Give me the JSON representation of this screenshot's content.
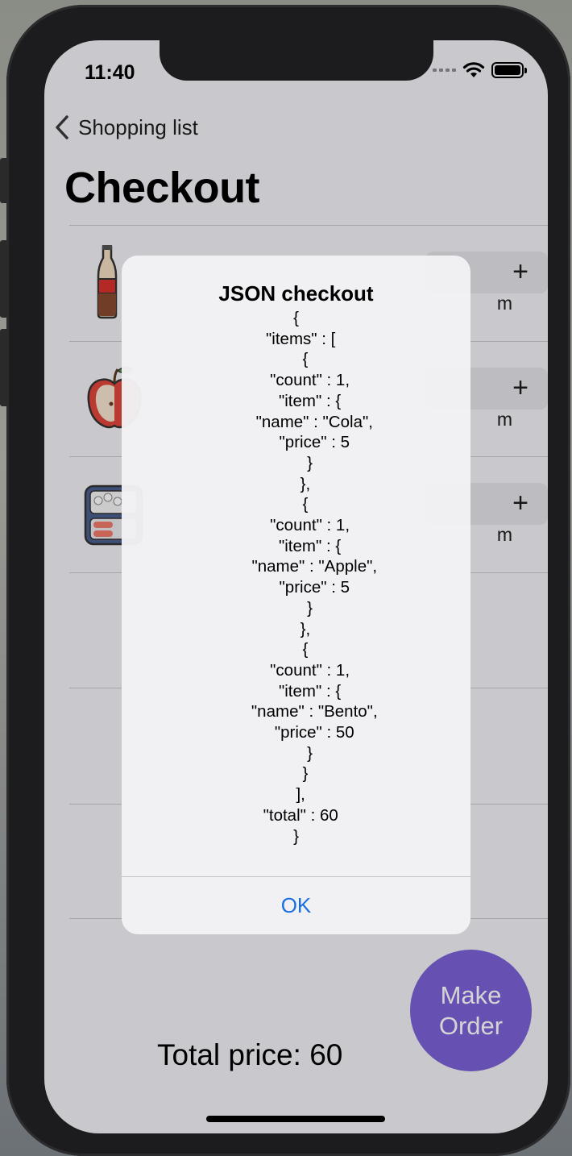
{
  "status_bar": {
    "time": "11:40"
  },
  "nav": {
    "back_label": "Shopping list",
    "title": "Checkout"
  },
  "items": [
    {
      "icon": "cola-bottle-icon",
      "plus": "+",
      "suffix": "m"
    },
    {
      "icon": "apple-icon",
      "plus": "+",
      "suffix": "m"
    },
    {
      "icon": "bento-box-icon",
      "plus": "+",
      "suffix": "m"
    }
  ],
  "total_label": "Total price: 60",
  "order_button": "Make Order",
  "alert": {
    "title": "JSON checkout",
    "message": "{\n  \"items\" : [\n    {\n      \"count\" : 1,\n      \"item\" : {\n        \"name\" : \"Cola\",\n        \"price\" : 5\n      }\n    },\n    {\n      \"count\" : 1,\n      \"item\" : {\n        \"name\" : \"Apple\",\n        \"price\" : 5\n      }\n    },\n    {\n      \"count\" : 1,\n      \"item\" : {\n        \"name\" : \"Bento\",\n        \"price\" : 50\n      }\n    }\n  ],\n  \"total\" : 60\n}",
    "ok_label": "OK"
  },
  "colors": {
    "accent": "#7b62d6",
    "link": "#1a6fe0",
    "background": "#f2f2f7"
  }
}
